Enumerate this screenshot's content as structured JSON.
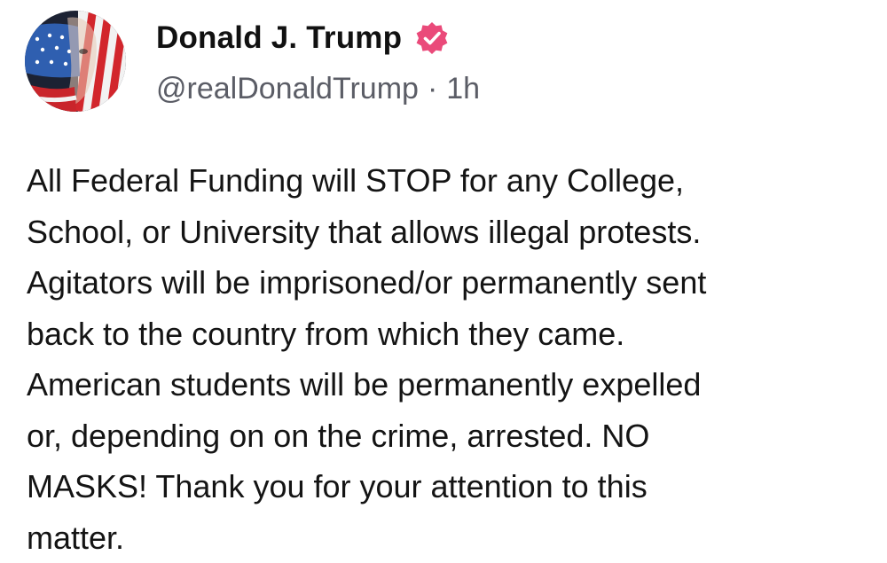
{
  "author": {
    "display_name": "Donald J. Trump",
    "handle": "@realDonaldTrump",
    "separator": "·",
    "timestamp": "1h",
    "avatar_icon": "flag-face-avatar",
    "verified_icon": "verified-badge-icon",
    "verified_color": "#ea4a7a"
  },
  "post": {
    "text": "All Federal Funding will STOP for any College,\nSchool, or University that allows illegal protests.\nAgitators will be imprisoned/or permanently sent\nback to the country from which they came.\nAmerican students will be permanently expelled\nor, depending on on the crime, arrested. NO\nMASKS! Thank you for your attention to this\nmatter."
  }
}
